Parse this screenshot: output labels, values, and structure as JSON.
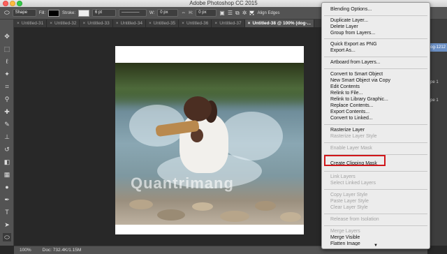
{
  "window": {
    "app_title": "Adobe Photoshop CC 2015"
  },
  "options_bar": {
    "mode_value": "Shape",
    "fill_label": "Fill:",
    "stroke_label": "Stroke:",
    "stroke_width": "6 pt",
    "w_label": "W:",
    "w_value": "0 px",
    "h_label": "H:",
    "h_value": "0 px",
    "align_edges_label": "Align Edges"
  },
  "tabs": [
    {
      "label": "Untitled-31"
    },
    {
      "label": "Untitled-32"
    },
    {
      "label": "Untitled-33"
    },
    {
      "label": "Untitled-34"
    },
    {
      "label": "Untitled-35"
    },
    {
      "label": "Untitled-36"
    },
    {
      "label": "Untitled-37"
    },
    {
      "label": "Untitled-38 @ 100% (dog-..."
    }
  ],
  "canvas": {
    "watermark": "Quantrimang"
  },
  "right_panel": {
    "rows": [
      {
        "label": "og-1212"
      },
      {
        "label": "pe 1"
      },
      {
        "label": "pe 1"
      }
    ]
  },
  "status": {
    "zoom": "100%",
    "doc": "Doc: 732.4K/1.15M"
  },
  "context_menu": {
    "items": [
      {
        "label": "Blending Options...",
        "disabled": false
      },
      {
        "label": "Duplicate Layer...",
        "disabled": false
      },
      {
        "label": "Delete Layer",
        "disabled": false
      },
      {
        "label": "Group from Layers...",
        "disabled": false
      },
      {
        "label": "Quick Export as PNG",
        "disabled": false
      },
      {
        "label": "Export As...",
        "disabled": false
      },
      {
        "label": "Artboard from Layers...",
        "disabled": false
      },
      {
        "label": "Convert to Smart Object",
        "disabled": false
      },
      {
        "label": "New Smart Object via Copy",
        "disabled": false
      },
      {
        "label": "Edit Contents",
        "disabled": false
      },
      {
        "label": "Relink to File...",
        "disabled": false
      },
      {
        "label": "Relink to Library Graphic...",
        "disabled": false
      },
      {
        "label": "Replace Contents...",
        "disabled": false
      },
      {
        "label": "Export Contents...",
        "disabled": false
      },
      {
        "label": "Convert to Linked...",
        "disabled": false
      },
      {
        "label": "Rasterize Layer",
        "disabled": false
      },
      {
        "label": "Rasterize Layer Style",
        "disabled": true
      },
      {
        "label": "Enable Layer Mask",
        "disabled": true
      },
      {
        "label": "Create Clipping Mask",
        "disabled": false
      },
      {
        "label": "Link Layers",
        "disabled": true
      },
      {
        "label": "Select Linked Layers",
        "disabled": true
      },
      {
        "label": "Copy Layer Style",
        "disabled": true
      },
      {
        "label": "Paste Layer Style",
        "disabled": true
      },
      {
        "label": "Clear Layer Style",
        "disabled": true
      },
      {
        "label": "Release from Isolation",
        "disabled": true
      },
      {
        "label": "Merge Layers",
        "disabled": true
      },
      {
        "label": "Merge Visible",
        "disabled": false
      },
      {
        "label": "Flatten Image",
        "disabled": false
      }
    ]
  },
  "colors": {
    "highlight": "#d0171b",
    "foreground_swatch": "#2f7de1"
  }
}
